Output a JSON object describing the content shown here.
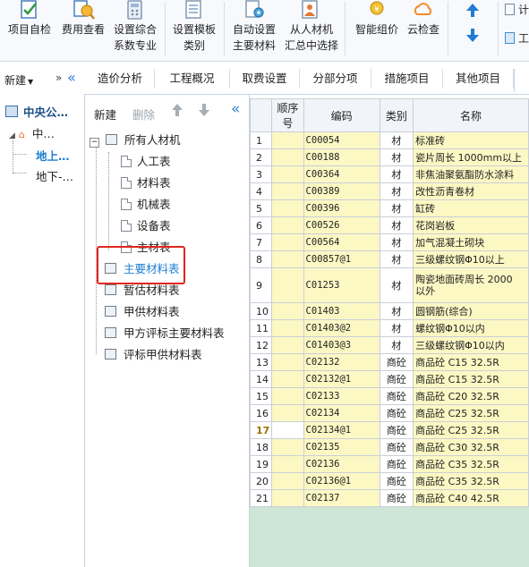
{
  "ribbon": {
    "buttons": [
      {
        "label1": "项目自检",
        "label2": "",
        "icon": "project-check-icon"
      },
      {
        "label1": "费用查看",
        "label2": "",
        "icon": "cost-view-icon"
      },
      {
        "label1": "设置综合",
        "label2": "系数专业",
        "icon": "coefficient-calculator-icon"
      },
      {
        "label1": "设置模板",
        "label2": "类别",
        "icon": "template-category-icon"
      },
      {
        "label1": "自动设置",
        "label2": "主要材料",
        "icon": "auto-settings-icon"
      },
      {
        "label1": "从人材机",
        "label2": "汇总中选择",
        "icon": "people-select-icon"
      },
      {
        "label1": "智能组价",
        "label2": "",
        "icon": "smart-pricing-icon"
      },
      {
        "label1": "云检查",
        "label2": "",
        "icon": "cloud-check-icon"
      }
    ],
    "up_arrow": "up-arrow-icon",
    "down_arrow": "down-arrow-icon",
    "right_items": [
      "计",
      "工"
    ]
  },
  "nav": {
    "new_label": "新建",
    "project_root": "中央公…",
    "project_child": "中…",
    "unit_above": "地上…",
    "unit_below": "地下-…"
  },
  "tabs": [
    "造价分析",
    "工程概况",
    "取费设置",
    "分部分项",
    "措施项目",
    "其他项目"
  ],
  "tree": {
    "new_label": "新建",
    "delete_label": "删除",
    "nodes": [
      {
        "label": "所有人材机"
      },
      {
        "label": "人工表"
      },
      {
        "label": "材料表"
      },
      {
        "label": "机械表"
      },
      {
        "label": "设备表"
      },
      {
        "label": "主材表"
      },
      {
        "label": "主要材料表"
      },
      {
        "label": "暂估材料表"
      },
      {
        "label": "甲供材料表"
      },
      {
        "label": "甲方评标主要材料表"
      },
      {
        "label": "评标甲供材料表"
      }
    ]
  },
  "grid": {
    "headers": [
      "",
      "顺序号",
      "编码",
      "类别",
      "名称"
    ],
    "rows": [
      {
        "n": "1",
        "code": "C00054",
        "cat": "材",
        "name": "标准砖"
      },
      {
        "n": "2",
        "code": "C00188",
        "cat": "材",
        "name": "瓷片周长 1000mm以上"
      },
      {
        "n": "3",
        "code": "C00364",
        "cat": "材",
        "name": "非焦油聚氨酯防水涂料"
      },
      {
        "n": "4",
        "code": "C00389",
        "cat": "材",
        "name": "改性沥青卷材"
      },
      {
        "n": "5",
        "code": "C00396",
        "cat": "材",
        "name": "缸砖"
      },
      {
        "n": "6",
        "code": "C00526",
        "cat": "材",
        "name": "花岗岩板"
      },
      {
        "n": "7",
        "code": "C00564",
        "cat": "材",
        "name": "加气混凝土砌块"
      },
      {
        "n": "8",
        "code": "C00857@1",
        "cat": "材",
        "name": "三级螺纹钢Φ10以上"
      },
      {
        "n": "9",
        "code": "C01253",
        "cat": "材",
        "name": "陶瓷地面砖周长 2000",
        "name2": "以外"
      },
      {
        "n": "10",
        "code": "C01403",
        "cat": "材",
        "name": "圆钢筋(综合)"
      },
      {
        "n": "11",
        "code": "C01403@2",
        "cat": "材",
        "name": "螺纹钢Φ10以内"
      },
      {
        "n": "12",
        "code": "C01403@3",
        "cat": "材",
        "name": "三级螺纹钢Φ10以内"
      },
      {
        "n": "13",
        "code": "C02132",
        "cat": "商砼",
        "name": "商品砼 C15 32.5R"
      },
      {
        "n": "14",
        "code": "C02132@1",
        "cat": "商砼",
        "name": "商品砼 C15 32.5R"
      },
      {
        "n": "15",
        "code": "C02133",
        "cat": "商砼",
        "name": "商品砼 C20 32.5R"
      },
      {
        "n": "16",
        "code": "C02134",
        "cat": "商砼",
        "name": "商品砼 C25 32.5R"
      },
      {
        "n": "17",
        "code": "C02134@1",
        "cat": "商砼",
        "name": "商品砼 C25 32.5R"
      },
      {
        "n": "18",
        "code": "C02135",
        "cat": "商砼",
        "name": "商品砼 C30 32.5R"
      },
      {
        "n": "19",
        "code": "C02136",
        "cat": "商砼",
        "name": "商品砼 C35 32.5R"
      },
      {
        "n": "20",
        "code": "C02136@1",
        "cat": "商砼",
        "name": "商品砼 C35 32.5R"
      },
      {
        "n": "21",
        "code": "C02137",
        "cat": "商砼",
        "name": "商品砼 C40 42.5R"
      }
    ]
  },
  "colors": {
    "highlight_box": "#e0251f",
    "selected_text": "#1e7fd2",
    "grid_yellow": "#fcf8c4",
    "grid_empty": "#cde6d6"
  }
}
